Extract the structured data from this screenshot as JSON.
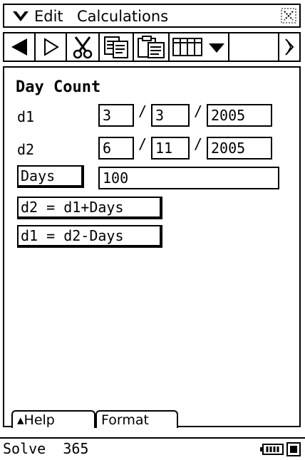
{
  "menubar": {
    "menu1": "Edit",
    "menu2": "Calculations"
  },
  "toolbar": {
    "icons": [
      "back-arrow-icon",
      "play-icon",
      "cut-icon",
      "copy-icon",
      "paste-icon",
      "table-icon",
      "dropdown-arrow-icon",
      "scroll-right-icon"
    ]
  },
  "main": {
    "title": "Day Count",
    "d1": {
      "label": "d1",
      "day": "3",
      "month": "3",
      "year": "2005"
    },
    "d2": {
      "label": "d2",
      "day": "6",
      "month": "11",
      "year": "2005"
    },
    "date_separator": "/",
    "days": {
      "button_label": "Days",
      "value": "100"
    },
    "calc_d2_label": "d2 = d1+Days",
    "calc_d1_label": "d1 = d2-Days"
  },
  "tabs": {
    "help": "▴Help",
    "format": "Format"
  },
  "status": {
    "mode": "Solve",
    "year_basis": "365"
  }
}
